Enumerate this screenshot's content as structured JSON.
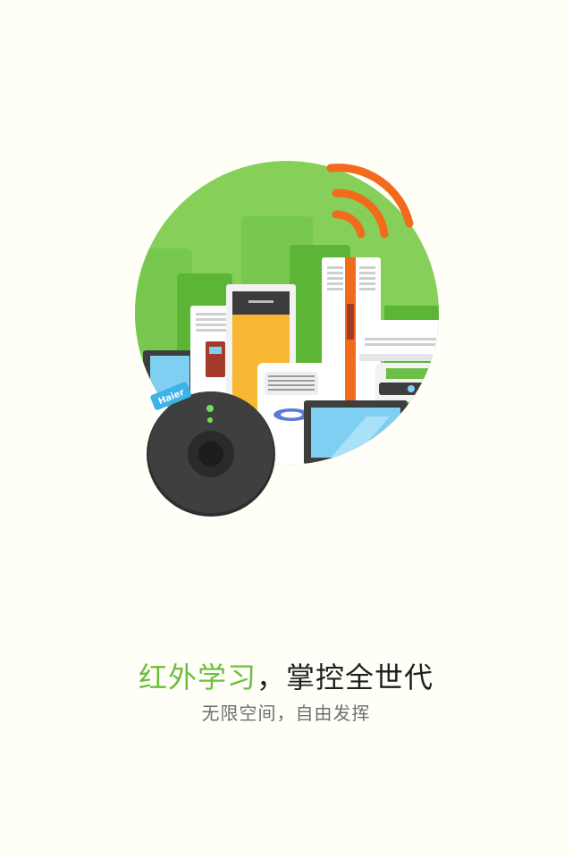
{
  "illustration": {
    "brand_badge": "Haier",
    "colors": {
      "circle": "#86d05a",
      "building": "#6cc04a",
      "signal": "#f26a1c",
      "speaker": "#3a3a3a",
      "yellow_panel": "#f7b733",
      "tv_screen": "#7fcff3"
    }
  },
  "headline": {
    "accent_text": "红外学习",
    "rest_text": "，掌控全世代"
  },
  "subline": "无限空间，自由发挥"
}
